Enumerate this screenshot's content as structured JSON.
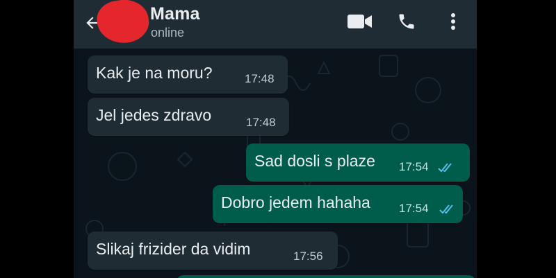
{
  "header": {
    "contact_name": "Mama",
    "status": "online"
  },
  "icons": {
    "back": "arrow-left-icon",
    "video": "video-call-icon",
    "call": "phone-icon",
    "menu": "more-vert-icon"
  },
  "messages": [
    {
      "direction": "incoming",
      "text": "Kak je na moru?",
      "time": "17:48"
    },
    {
      "direction": "incoming",
      "text": "Jel jedes zdravo",
      "time": "17:48"
    },
    {
      "direction": "outgoing",
      "text": "Sad dosli s plaze",
      "time": "17:54",
      "read": true
    },
    {
      "direction": "outgoing",
      "text": "Dobro jedem hahaha",
      "time": "17:54",
      "read": true
    },
    {
      "direction": "incoming",
      "text": "Slikaj frizider da vidim",
      "time": "17:56"
    }
  ],
  "colors": {
    "header_bg": "#1f2c34",
    "chat_bg": "#0b141a",
    "incoming_bubble": "#202c33",
    "outgoing_bubble": "#005c4b",
    "read_tick": "#53bdeb",
    "redaction": "#e4262d"
  }
}
